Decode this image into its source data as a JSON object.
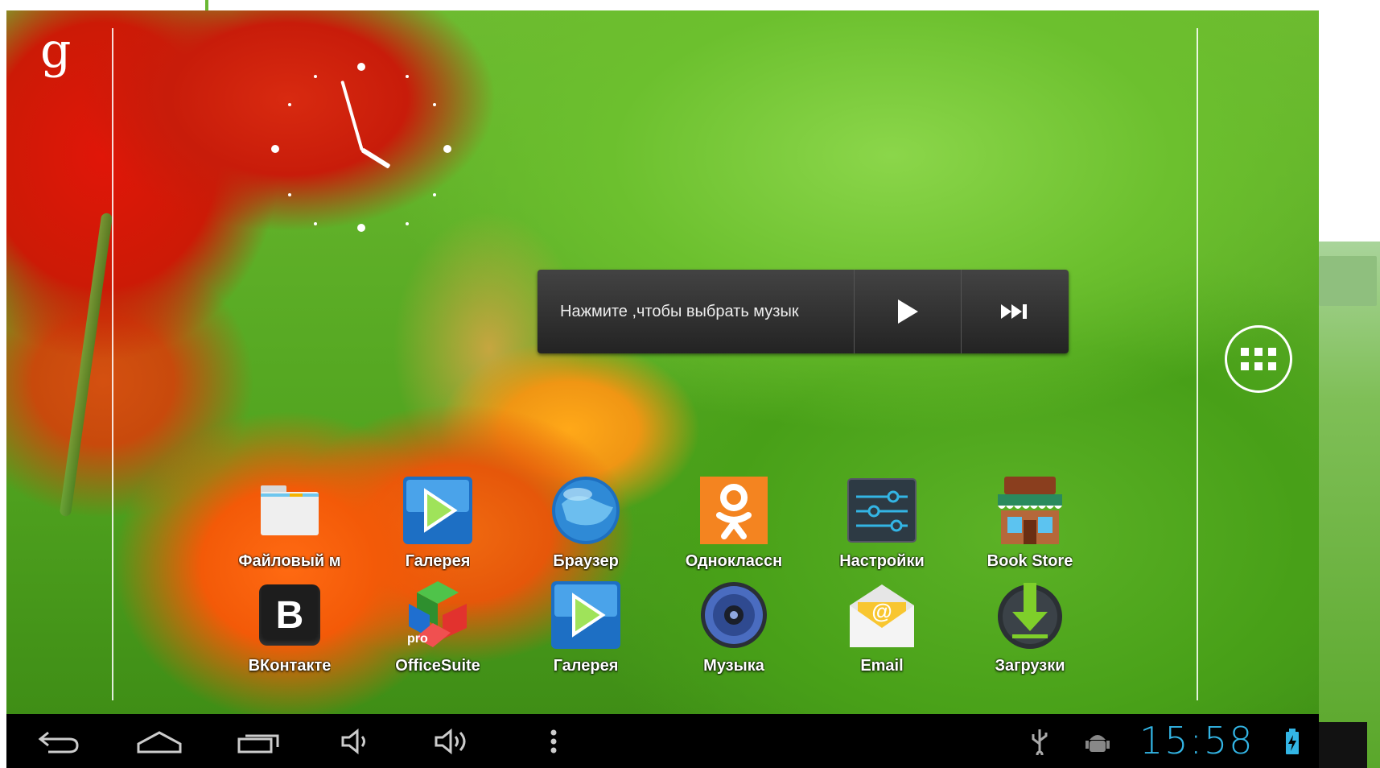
{
  "desktop": {
    "google_search_glyph": "g",
    "clock_widget_icon": "analog-clock-icon"
  },
  "music_widget": {
    "prompt": "Нажмите ,чтобы выбрать музык",
    "play_icon": "play-icon",
    "next_icon": "skip-next-icon"
  },
  "apps_drawer_icon": "all-apps-grid-icon",
  "apps": {
    "row1": [
      {
        "label": "Файловый м",
        "icon": "folder-icon"
      },
      {
        "label": "Галерея",
        "icon": "gallery-play-icon"
      },
      {
        "label": "Браузер",
        "icon": "globe-icon"
      },
      {
        "label": "Одноклассн",
        "icon": "odnoklassniki-icon"
      },
      {
        "label": "Настройки",
        "icon": "settings-sliders-icon"
      },
      {
        "label": "Book Store",
        "icon": "store-icon"
      }
    ],
    "row2": [
      {
        "label": "ВКонтакте",
        "icon": "vk-icon",
        "glyph": "B"
      },
      {
        "label": "OfficeSuite",
        "icon": "officesuite-icon",
        "badge": "pro"
      },
      {
        "label": "Галерея",
        "icon": "gallery-play-icon"
      },
      {
        "label": "Музыка",
        "icon": "speaker-icon"
      },
      {
        "label": "Email",
        "icon": "email-icon",
        "glyph": "@"
      },
      {
        "label": "Загрузки",
        "icon": "download-icon"
      }
    ]
  },
  "navbar": {
    "icons": [
      "back-icon",
      "home-icon",
      "recent-apps-icon",
      "volume-down-icon",
      "volume-up-icon",
      "menu-icon"
    ],
    "status_icons": [
      "usb-icon",
      "android-debug-icon",
      "battery-charging-icon"
    ],
    "time": "15:58"
  },
  "colors": {
    "clock_accent": "#33b5e5",
    "navbar_bg": "#000000",
    "widget_bg": "#2b2b2b"
  }
}
